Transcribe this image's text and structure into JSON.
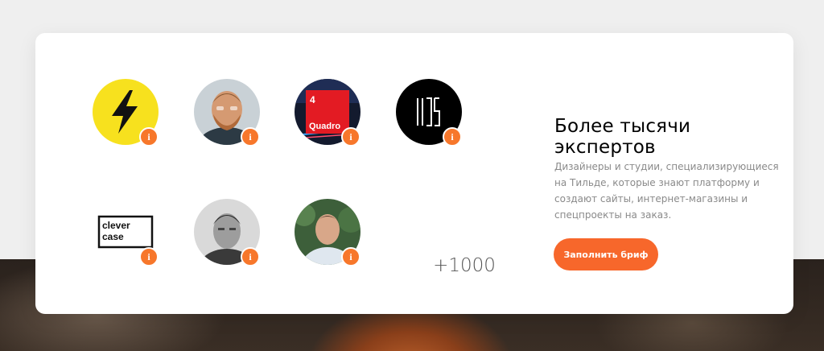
{
  "experts": {
    "title": "Более тысячи экспертов",
    "description": "Дизайнеры и студии, специализирующиеся на Тильде, которые знают платформу и создают сайты, интернет-магазины и спецпроекты на заказ.",
    "cta_label": "Заполнить бриф",
    "more_count": "+1000",
    "info_glyph": "i",
    "avatars": [
      {
        "name": "lightning-logo",
        "logo_text": ""
      },
      {
        "name": "expert-photo-1",
        "logo_text": ""
      },
      {
        "name": "quadro-logo",
        "logo_text": "Quadro",
        "logo_number": "4"
      },
      {
        "name": "ios-logo",
        "logo_text": ""
      },
      {
        "name": "clever-case-logo",
        "logo_text_1": "clever",
        "logo_text_2": "case"
      },
      {
        "name": "expert-photo-2",
        "logo_text": ""
      },
      {
        "name": "expert-photo-3",
        "logo_text": ""
      }
    ]
  },
  "colors": {
    "accent": "#f7672b",
    "badge": "#f7772b",
    "lightning_yellow": "#f7e11e",
    "quadro_red": "#e31b23"
  }
}
